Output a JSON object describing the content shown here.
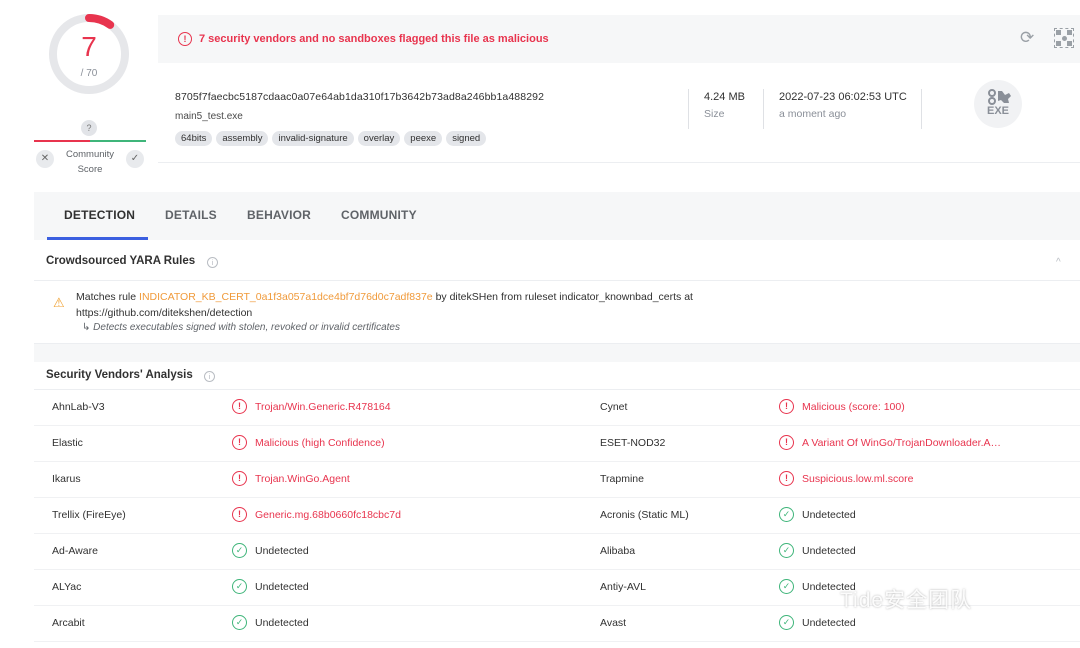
{
  "score": {
    "detections": "7",
    "total": "/ 70",
    "community_badge": "?",
    "community_label_1": "Community",
    "community_label_2": "Score",
    "vote_down": "✕",
    "vote_up": "✓"
  },
  "banner": {
    "warning_glyph": "!",
    "message": "7 security vendors and no sandboxes flagged this file as malicious",
    "reload_glyph": "⟳"
  },
  "file": {
    "sha256": "8705f7faecbc5187cdaac0a07e64ab1da310f17b3642b73ad8a246bb1a488292",
    "name": "main5_test.exe",
    "tags": [
      "64bits",
      "assembly",
      "invalid-signature",
      "overlay",
      "peexe",
      "signed"
    ],
    "size": "4.24 MB",
    "size_label": "Size",
    "date": "2022-07-23 06:02:53 UTC",
    "date_relative": "a moment ago",
    "type_icon_text": "EXE"
  },
  "tabs": [
    "DETECTION",
    "DETAILS",
    "BEHAVIOR",
    "COMMUNITY"
  ],
  "yara": {
    "section_title": "Crowdsourced YARA Rules",
    "info_glyph": "i",
    "collapse_glyph": "^",
    "warn_glyph": "⚠",
    "prefix": "Matches rule ",
    "rule_name": "INDICATOR_KB_CERT_0a1f3a057a1dce4bf7d76d0c7adf837e",
    "by_text": " by ditekSHen from ruleset indicator_knownbad_certs at",
    "source": "https://github.com/ditekshen/detection",
    "description": "Detects executables signed with stolen, revoked or invalid certificates",
    "arrow": "↳"
  },
  "vendors_section": {
    "title": "Security Vendors' Analysis",
    "info_glyph": "i"
  },
  "glyphs": {
    "malicious": "!",
    "undetected": "✓"
  },
  "vendors": [
    {
      "left": {
        "name": "AhnLab-V3",
        "result": "Trojan/Win.Generic.R478164",
        "malicious": true
      },
      "right": {
        "name": "Cynet",
        "result": "Malicious (score: 100)",
        "malicious": true
      }
    },
    {
      "left": {
        "name": "Elastic",
        "result": "Malicious (high Confidence)",
        "malicious": true
      },
      "right": {
        "name": "ESET-NOD32",
        "result": "A Variant Of WinGo/TrojanDownloader.A…",
        "malicious": true
      }
    },
    {
      "left": {
        "name": "Ikarus",
        "result": "Trojan.WinGo.Agent",
        "malicious": true
      },
      "right": {
        "name": "Trapmine",
        "result": "Suspicious.low.ml.score",
        "malicious": true
      }
    },
    {
      "left": {
        "name": "Trellix (FireEye)",
        "result": "Generic.mg.68b0660fc18cbc7d",
        "malicious": true
      },
      "right": {
        "name": "Acronis (Static ML)",
        "result": "Undetected",
        "malicious": false
      }
    },
    {
      "left": {
        "name": "Ad-Aware",
        "result": "Undetected",
        "malicious": false
      },
      "right": {
        "name": "Alibaba",
        "result": "Undetected",
        "malicious": false
      }
    },
    {
      "left": {
        "name": "ALYac",
        "result": "Undetected",
        "malicious": false
      },
      "right": {
        "name": "Antiy-AVL",
        "result": "Undetected",
        "malicious": false
      }
    },
    {
      "left": {
        "name": "Arcabit",
        "result": "Undetected",
        "malicious": false
      },
      "right": {
        "name": "Avast",
        "result": "Undetected",
        "malicious": false
      }
    }
  ],
  "watermark": "Tide安全团队",
  "colors": {
    "malicious": "#e8344e",
    "undetected": "#3fb57a",
    "accent": "#3b5fe0",
    "yara_rule": "#f09a3a"
  }
}
